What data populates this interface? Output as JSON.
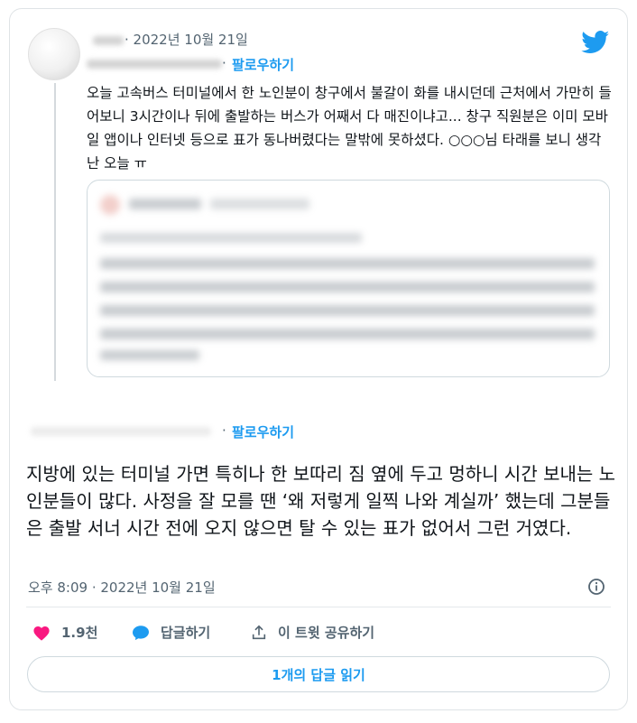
{
  "quoted_tweet": {
    "date": "· 2022년 10월 21일",
    "follow_label": "팔로우하기",
    "text": "오늘 고속버스 터미널에서 한 노인분이 창구에서 불갈이 화를 내시던데 근처에서 가만히 들어보니 3시간이나 뒤에 출발하는 버스가 어째서 다 매진이냐고... 창구 직원분은 이미 모바일 앱이나 인터넷 등으로 표가 동나버렸다는 말밖에 못하셨다. ○○○님 타래를 보니 생각난 오늘 ㅠ"
  },
  "main_tweet": {
    "follow_label": "팔로우하기",
    "text": "지방에 있는 터미널 가면 특히나 한 보따리 짐 옆에 두고 멍하니 시간 보내는 노인분들이 많다. 사정을 잘 모를 땐 ‘왜 저렇게 일찍 나와 계실까’ 했는데 그분들은 출발 서너 시간 전에 오지 않으면 탈 수 있는 표가 없어서 그런 거였다.",
    "timestamp": "오후 8:09 · 2022년 10월 21일"
  },
  "actions": {
    "like_count": "1.9천",
    "reply_label": "답글하기",
    "share_label": "이 트윗 공유하기"
  },
  "read_replies_label": "1개의 답글 읽기",
  "icons": {
    "brand": "twitter-icon",
    "like": "heart-icon",
    "reply": "reply-bubble-icon",
    "share": "share-icon",
    "info": "info-icon"
  },
  "colors": {
    "accent": "#1d9bf0",
    "heart": "#f91880",
    "text": "#0f1419",
    "secondary": "#536471"
  }
}
